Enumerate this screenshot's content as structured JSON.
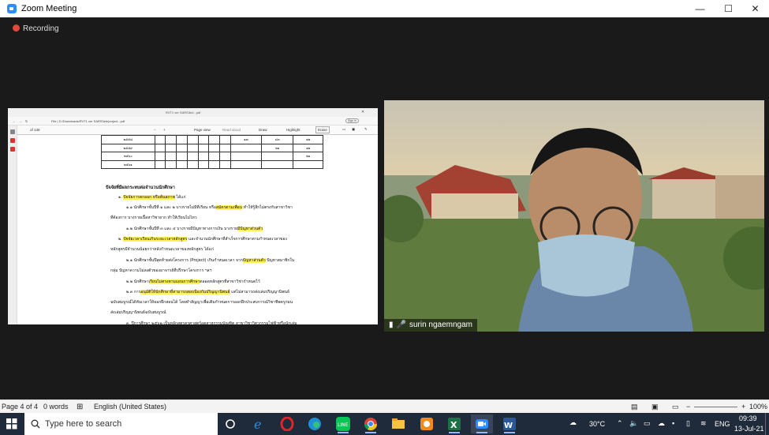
{
  "window": {
    "title": "Zoom Meeting"
  },
  "recording": {
    "label": "Recording"
  },
  "participant": {
    "name": "surin ngaemngam"
  },
  "shared_doc": {
    "browser_tab": "RVT1 ver SARS3ed...pdf",
    "address": "File | D:/Downloads/RVT1 ver SARS3ed/project...pdf",
    "sign_in": "Sign in",
    "page_field": "of 136",
    "toolbar": {
      "page_view": "Page view",
      "read_aloud": "Read aloud",
      "draw": "Draw",
      "highlight": "Highlight",
      "erase": "Erase"
    },
    "table_rows": [
      {
        "year": "๒๕๕๘",
        "c9": "๑๗",
        "c10": "๘๓",
        "c11": "๑๒"
      },
      {
        "year": "๒๕๕๙",
        "c9": "",
        "c10": "๒๑",
        "c11": "๑๒"
      },
      {
        "year": "๒๕๖๐",
        "c9": "",
        "c10": "",
        "c11": "๒๑"
      },
      {
        "year": "๒๕๖๑",
        "c9": "",
        "c10": "",
        "c11": ""
      }
    ],
    "heading": "ปัจจัยที่มีผลกระทบต่อจำนวนนักศึกษา",
    "lines": [
      {
        "pre": "๑. ",
        "hl": "ปัจจัยการตกออก หรือพ้นสภาพ",
        "post": " ได้แก่"
      },
      {
        "pre": "๑.๑ นักศึกษาชั้นปีที่ ๑ และ ๒ บางรายไม่มีที่เรียน หรือ",
        "hl": "สมัครตามเพื่อน",
        "post": " ทำให้รู้สึกไม่ตรงกับสาขาวิชา"
      },
      {
        "pre": "ที่ต้องการ บางรายเนื้อหาวิชายาก ทำให้เรียนไม่ไหว",
        "hl": "",
        "post": ""
      },
      {
        "pre": "๑.๒ นักศึกษาชั้นปีที่ ๓ และ ๔ บางรายมีปัญหาทางการเงิน บางราย",
        "hl": "มีปัญหาส่วนตัว",
        "post": ""
      },
      {
        "pre": "๒. ",
        "hl": "ปัจจัยเวลาเรียนเกินระยะเวลาหลักสูตร",
        "post": " และจำนวนนักศึกษาที่สำเร็จการศึกษาตามกำหนดเวลาของ"
      },
      {
        "pre": "หลักสูตรมีจำนวนน้อยกว่าหลังกำหนดเวลาของหลักสูตร ได้แก่",
        "hl": "",
        "post": ""
      },
      {
        "pre": "๒.๑ นักศึกษาชั้นปีสุดท้ายส่งโครงการ (Project) เกินกำหนดเวลา จาก",
        "hl": "ปัญหาส่วนตัว",
        "post": " ปัญหาสมาชิกใน"
      },
      {
        "pre": "กลุ่ม ปัญหาความไม่ลงตัวของอาจารย์ที่ปรึกษาโครงการ ฯลฯ",
        "hl": "",
        "post": ""
      },
      {
        "pre": "๒.๒ นักศึกษา",
        "hl": "เรียนไม่ตรงตามแผนการศึกษา",
        "post": "ตลอดหลักสูตรที่สาขาวิชากำหนดไว้"
      },
      {
        "pre": "๒.๓ การ",
        "hl": "อนุมัติให้นักศึกษาที่สามารถสอบป้องกันปริญญานิพนธ์",
        "post": " แต่ไม่สามารถส่งเล่มปริญญานิพนธ์"
      },
      {
        "pre": "ฉบับสมบูรณ์ได้ทันเวลาให้ออกฝึกสอนได้ โดยทำสัญญาเพื่อเติมกำหนดการออกฝึกประสบการณ์วิชาชีพครูก่อน",
        "hl": "",
        "post": ""
      },
      {
        "pre": "ส่งเล่มปริญญานิพนธ์ฉบับสมบูรณ์",
        "hl": "",
        "post": ""
      },
      {
        "pre": "๓. ปีการศึกษา ๒๕๖๒ เป็นหลักสูตรครุศาสตร์อุตสาหกรรมบัณฑิต สาขาวิชาวิศวกรรมไฟฟ้าหรือนักเล่ม",
        "hl": "",
        "post": ""
      }
    ]
  },
  "statusbar": {
    "page": "Page 4 of 4",
    "words": "0 words",
    "language": "English (United States)",
    "zoom": "100%"
  },
  "taskbar": {
    "search_placeholder": "Type here to search",
    "weather": "30°C",
    "lang": "ENG",
    "time": "09:39",
    "date": "13-Jul-21"
  }
}
